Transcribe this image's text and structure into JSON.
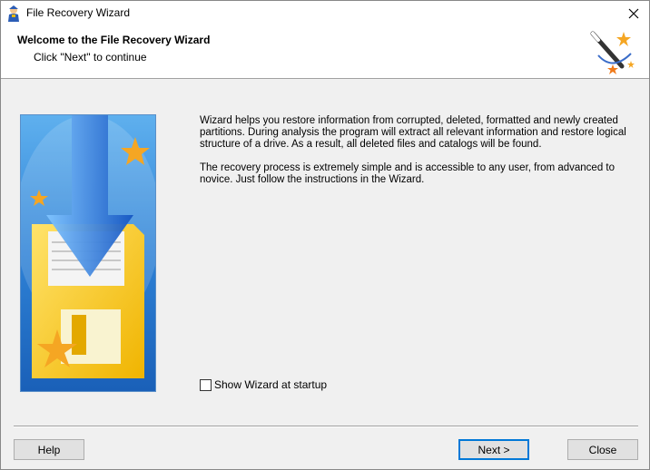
{
  "window": {
    "title": "File Recovery Wizard"
  },
  "header": {
    "title": "Welcome to the File Recovery Wizard",
    "subtitle": "Click \"Next\" to continue"
  },
  "content": {
    "paragraph1": "Wizard helps you restore information from corrupted, deleted, formatted and newly created partitions. During analysis the program will extract all relevant information and restore logical structure of a drive. As a result, all deleted files and catalogs will be found.",
    "paragraph2": "The recovery process is extremely simple and is accessible to any user, from advanced to novice. Just follow the instructions in the Wizard.",
    "show_wizard_label": "Show Wizard at startup",
    "show_wizard_checked": false
  },
  "buttons": {
    "help": "Help",
    "next": "Next >",
    "close": "Close"
  },
  "icons": {
    "app": "wizard-person-icon",
    "header": "magic-wand-icon",
    "close": "close-icon"
  }
}
